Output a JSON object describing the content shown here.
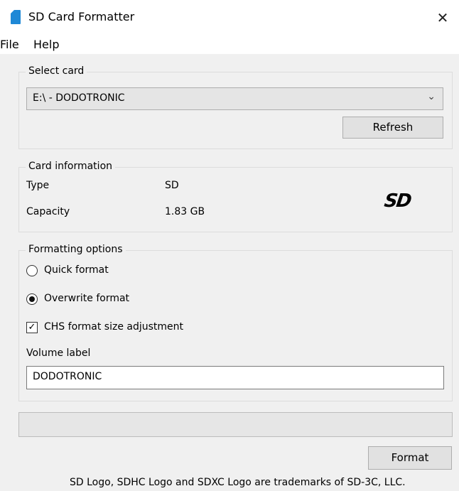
{
  "window": {
    "title": "SD Card Formatter"
  },
  "menu": {
    "file": "File",
    "help": "Help"
  },
  "select_card": {
    "legend": "Select card",
    "selected": "E:\\ - DODOTRONIC",
    "refresh_label": "Refresh"
  },
  "card_info": {
    "legend": "Card information",
    "type_label": "Type",
    "type_value": "SD",
    "capacity_label": "Capacity",
    "capacity_value": "1.83 GB",
    "logo_text": "SD"
  },
  "formatting": {
    "legend": "Formatting options",
    "quick_label": "Quick format",
    "overwrite_label": "Overwrite format",
    "chs_label": "CHS format size adjustment",
    "volume_label_title": "Volume label",
    "volume_label_value": "DODOTRONIC",
    "selected_mode": "overwrite",
    "chs_checked": true
  },
  "progress": {
    "fraction": 0
  },
  "format_button": "Format",
  "footer_text": "SD Logo, SDHC Logo and SDXC Logo are trademarks of SD-3C, LLC."
}
